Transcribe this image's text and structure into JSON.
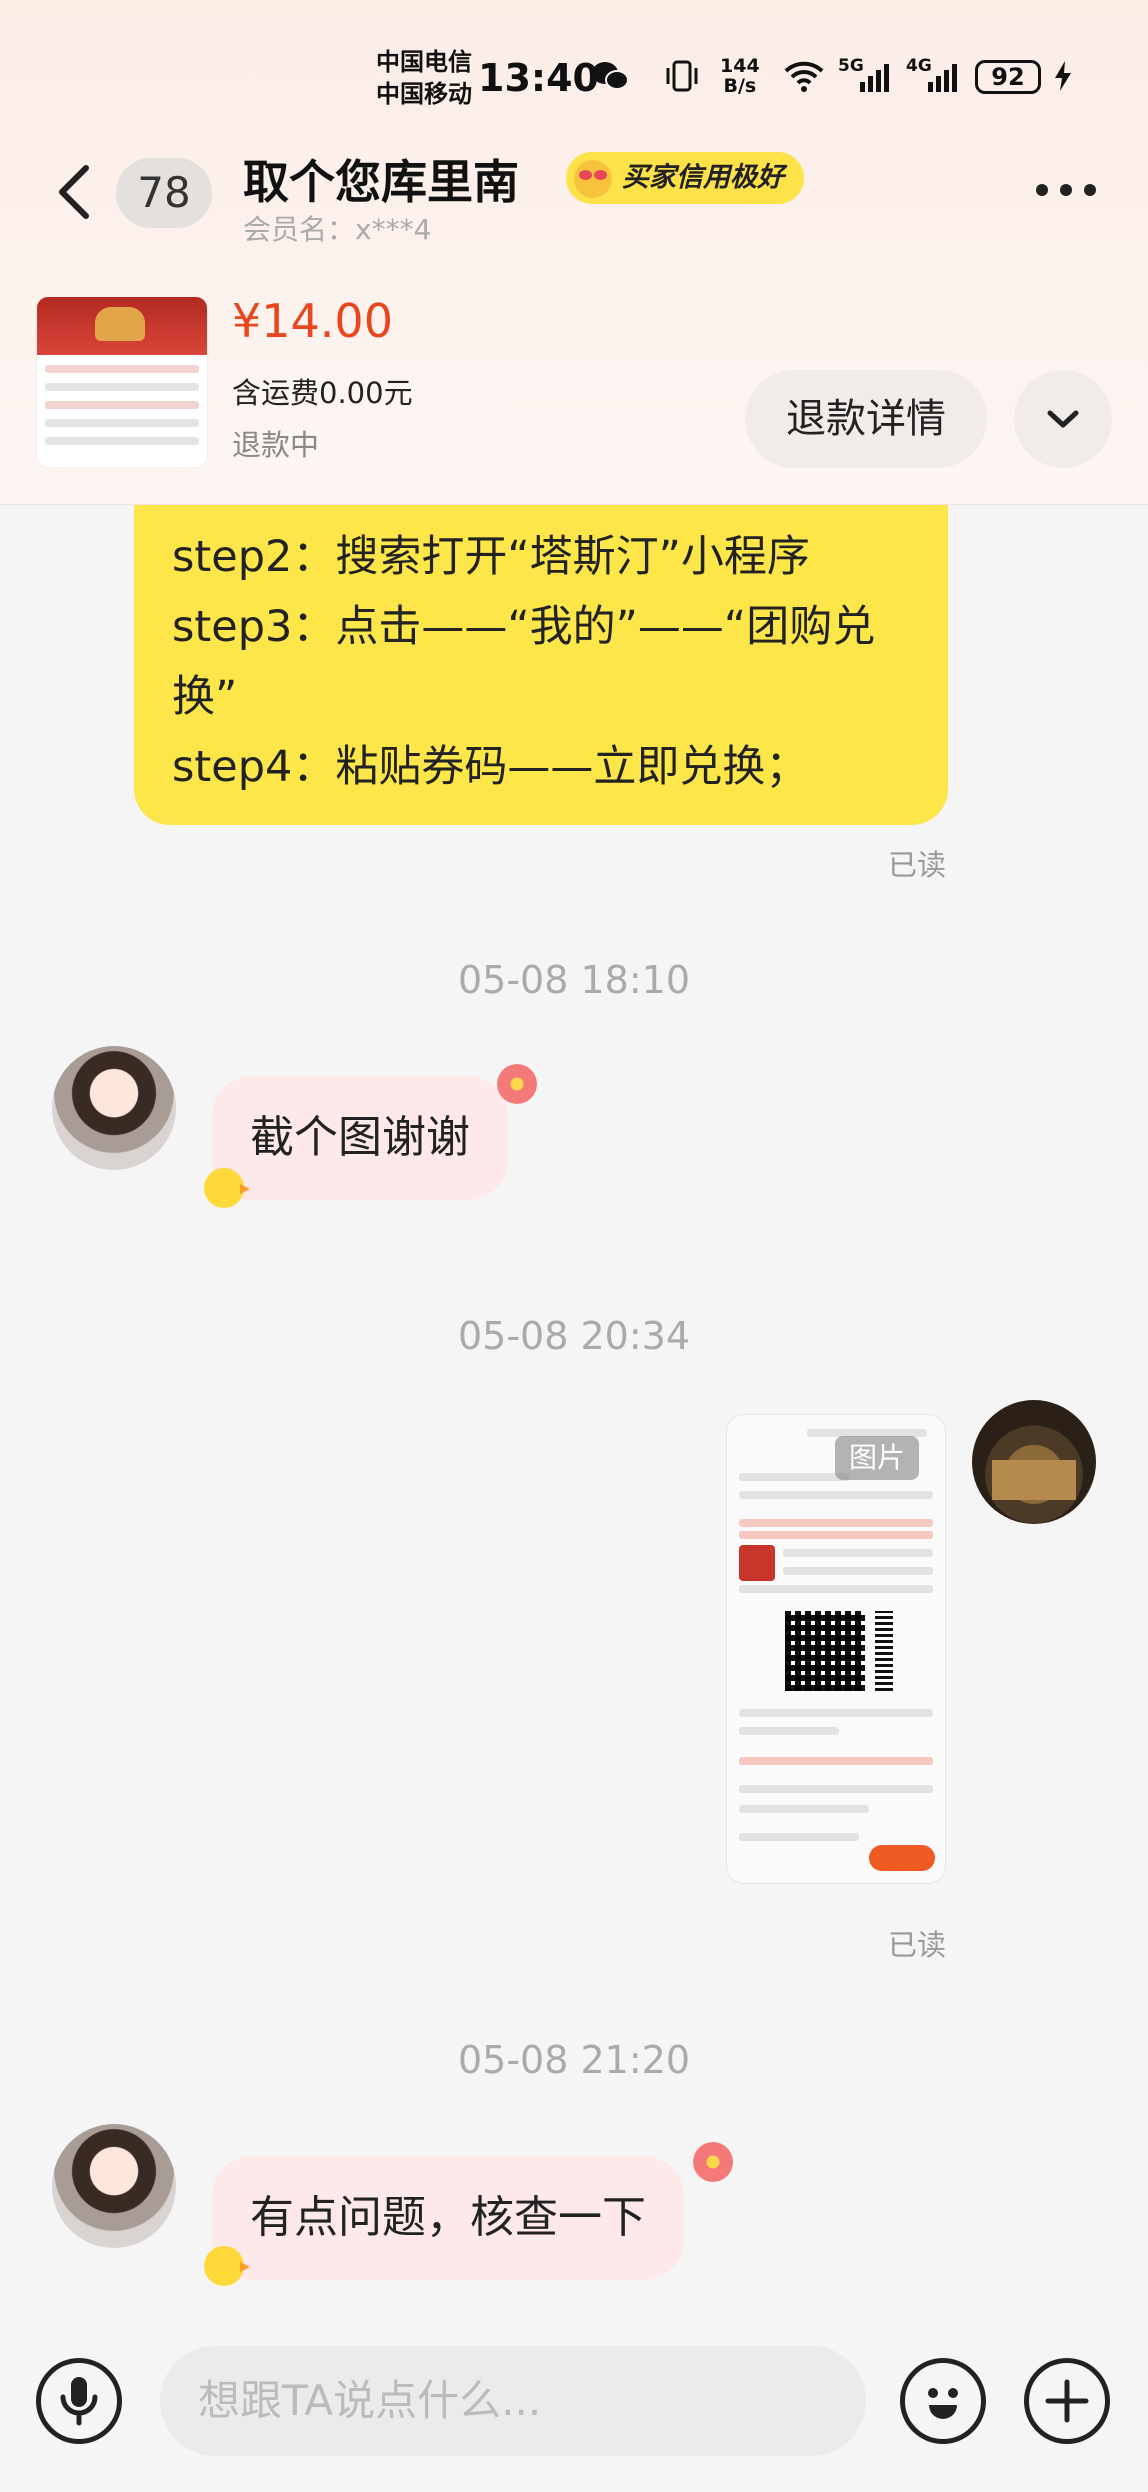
{
  "status_bar": {
    "carrier_1": "中国电信",
    "carrier_2": "中国移动",
    "time": "13:40",
    "speed_value": "144",
    "speed_unit": "B/s",
    "signal_1": "5G",
    "signal_2": "4G",
    "battery": "92"
  },
  "header": {
    "unread_count": "78",
    "title": "取个您库里南",
    "credit_badge": "买家信用极好",
    "member_label": "会员名：x***4"
  },
  "order": {
    "price": "¥14.00",
    "shipping": "含运费0.00元",
    "status": "退款中",
    "refund_detail_button": "退款详情"
  },
  "messages": {
    "seller_steps": [
      "step2：搜索打开“塔斯汀”小程序",
      "step3：点击——“我的”——“团购兑",
      "换”",
      "step4：粘贴券码——立即兑换；"
    ],
    "read_label": "已读",
    "timestamp_1": "05-08 18:10",
    "buyer_msg_1": "截个图谢谢",
    "timestamp_2": "05-08 20:34",
    "image_label": "图片",
    "timestamp_3": "05-08 21:20",
    "buyer_msg_2": "有点问题，核查一下"
  },
  "input_bar": {
    "placeholder": "想跟TA说点什么..."
  },
  "colors": {
    "price": "#e8461e",
    "steps_bubble": "#fce64a",
    "buyer_bubble": "#fde9ea",
    "credit_badge": "#fde24a"
  }
}
